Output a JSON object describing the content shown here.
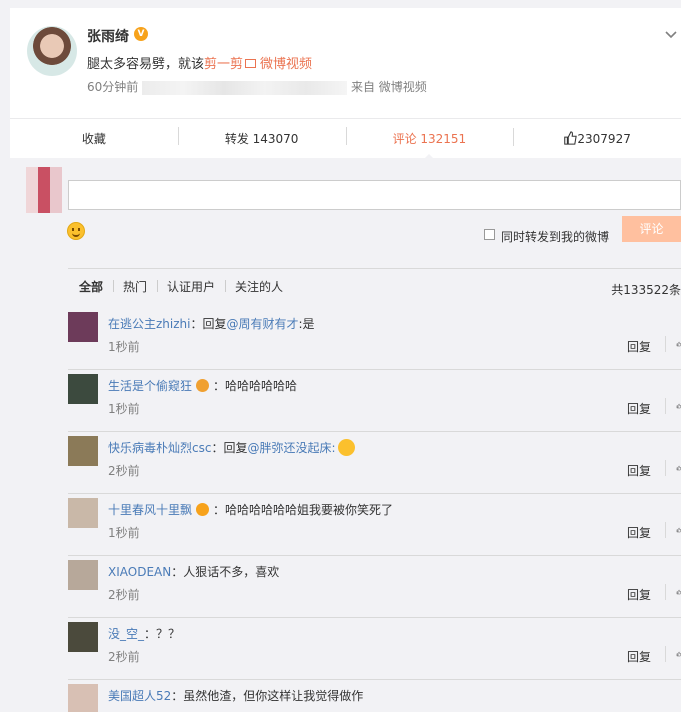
{
  "post": {
    "author": "张雨绮",
    "verified_badge": "V",
    "text_start": "腿太多容易劈，就该",
    "text_highlight": "剪一剪",
    "text_link": "微博视频",
    "time": "60分钟前",
    "source": "来自 微博视频"
  },
  "actions": {
    "favorite": "收藏",
    "repost": "转发 143070",
    "comment": "评论 132151",
    "like": "2307927"
  },
  "composer": {
    "placeholder": "",
    "repost_label": "同时转发到我的微博",
    "submit_label": "评论"
  },
  "filters": {
    "tabs": [
      "全部",
      "热门",
      "认证用户",
      "关注的人"
    ],
    "total": "共133522条"
  },
  "comments": [
    {
      "user": "在逃公主zhizhi",
      "text_pre": "：回复",
      "mention": "@周有财有才",
      "text_post": ":是",
      "time": "1秒前",
      "reply": "回复",
      "avatar_color": "#6d3b5a"
    },
    {
      "user": "生活是个偷窥狂",
      "text_pre": "：哈哈哈哈哈哈",
      "mention": "",
      "text_post": "",
      "time": "1秒前",
      "reply": "回复",
      "avatar_color": "#3c4a3e"
    },
    {
      "user": "快乐病毒朴灿烈csc",
      "text_pre": "：回复",
      "mention": "@胖弥还没起床:",
      "text_post": "",
      "time": "2秒前",
      "reply": "回复",
      "avatar_color": "#8b7a58"
    },
    {
      "user": "十里春风十里飘",
      "text_pre": "：哈哈哈哈哈哈姐我要被你笑死了",
      "mention": "",
      "text_post": "",
      "time": "1秒前",
      "reply": "回复",
      "avatar_color": "#c9b8a8"
    },
    {
      "user": "XIAODEAN",
      "text_pre": "：人狠话不多，喜欢",
      "mention": "",
      "text_post": "",
      "time": "2秒前",
      "reply": "回复",
      "avatar_color": "#b7a89a"
    },
    {
      "user": "没_空_",
      "text_pre": "：？？",
      "mention": "",
      "text_post": "",
      "time": "2秒前",
      "reply": "回复",
      "avatar_color": "#4b4a3c"
    },
    {
      "user": "美国超人52",
      "text_pre": "：虽然他渣，但你这样让我觉得做作",
      "mention": "",
      "text_post": "",
      "time": "",
      "reply": "",
      "avatar_color": "#d8c0b4"
    }
  ]
}
